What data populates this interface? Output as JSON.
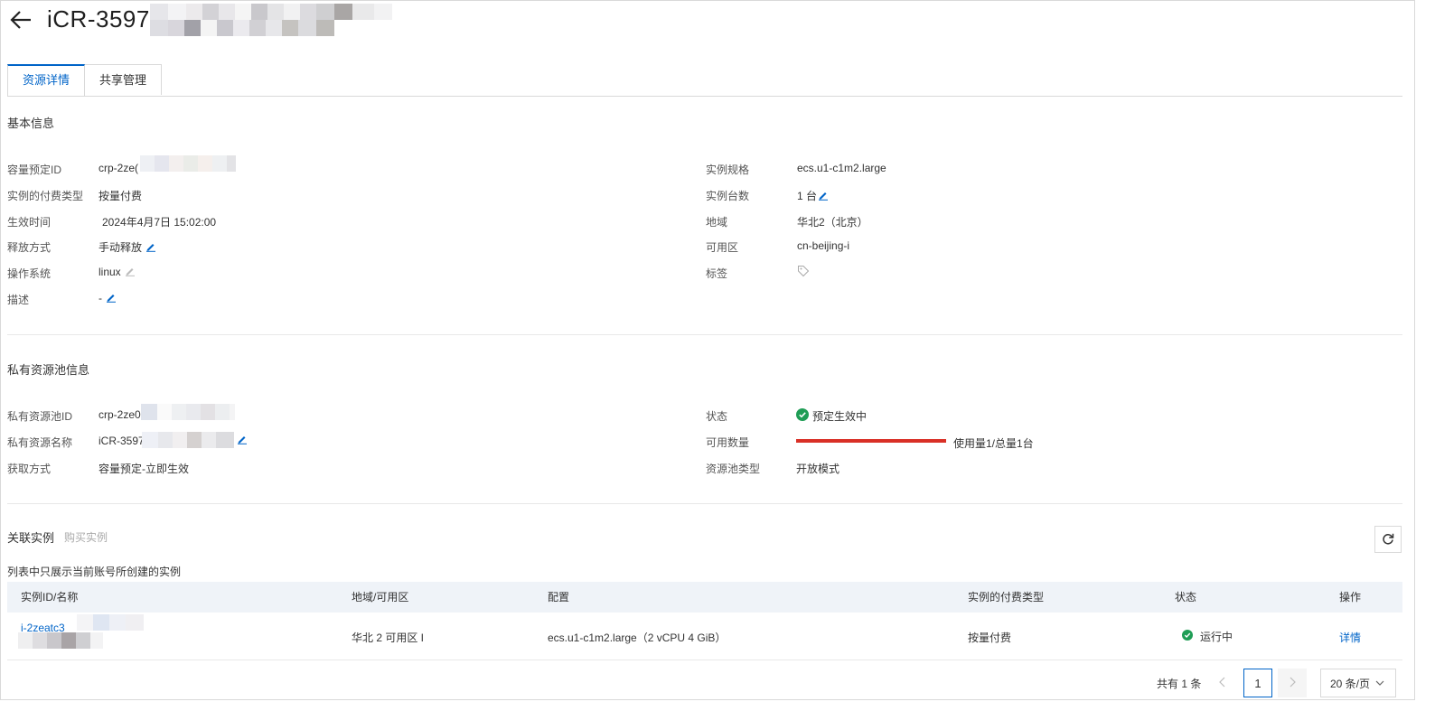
{
  "header": {
    "title": "iCR-3597"
  },
  "tabs": [
    {
      "label": "资源详情",
      "active": true
    },
    {
      "label": "共享管理",
      "active": false
    }
  ],
  "basic": {
    "section_title": "基本信息",
    "left": [
      {
        "label": "容量预定ID",
        "value": "crp-2ze("
      },
      {
        "label": "实例的付费类型",
        "value": "按量付费"
      },
      {
        "label": "生效时间",
        "value": "2024年4月7日 15:02:00"
      },
      {
        "label": "释放方式",
        "value": "手动释放"
      },
      {
        "label": "操作系统",
        "value": "linux"
      },
      {
        "label": "描述",
        "value": "-"
      }
    ],
    "right": [
      {
        "label": "实例规格",
        "value": "ecs.u1-c1m2.large"
      },
      {
        "label": "实例台数",
        "value": "1 台"
      },
      {
        "label": "地域",
        "value": "华北2（北京）"
      },
      {
        "label": "可用区",
        "value": "cn-beijing-i"
      },
      {
        "label": "标签",
        "value": ""
      }
    ]
  },
  "pool": {
    "section_title": "私有资源池信息",
    "left": [
      {
        "label": "私有资源池ID",
        "value": "crp-2ze0l"
      },
      {
        "label": "私有资源名称",
        "value": "iCR-3597"
      },
      {
        "label": "获取方式",
        "value": "容量预定-立即生效"
      }
    ],
    "right": [
      {
        "label": "状态",
        "value": "预定生效中"
      },
      {
        "label": "可用数量",
        "value": "使用量1/总量1台"
      },
      {
        "label": "资源池类型",
        "value": "开放模式"
      }
    ],
    "usage_fraction": 1.0,
    "usage_color": "#d93026"
  },
  "instances": {
    "section_title": "关联实例",
    "buy_link": "购买实例",
    "note": "列表中只展示当前账号所创建的实例",
    "columns": [
      "实例ID/名称",
      "地域/可用区",
      "配置",
      "实例的付费类型",
      "状态",
      "操作"
    ],
    "rows": [
      {
        "id": "i-2zeatc3",
        "region": "华北 2 可用区 I",
        "config": "ecs.u1-c1m2.large（2 vCPU 4 GiB）",
        "pay": "按量付费",
        "status": "运行中",
        "action": "详情"
      }
    ]
  },
  "pager": {
    "total": "共有 1 条",
    "current": "1",
    "page_size": "20 条/页"
  },
  "colors": {
    "accent": "#0064c8",
    "success": "#1f9d55"
  }
}
